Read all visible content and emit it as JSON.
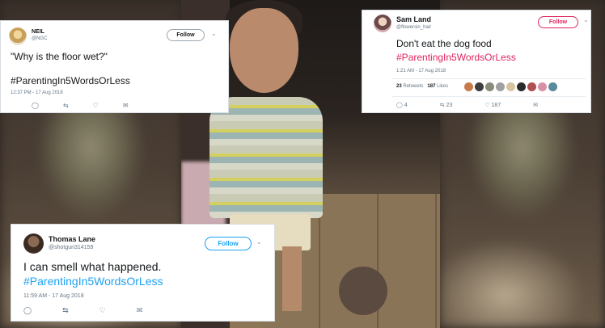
{
  "tweets": [
    {
      "name": "NEIL",
      "handle": "@NGC",
      "follow_label": "Follow",
      "text": "\"Why is the floor wet?\"",
      "hashtag": "#ParentingIn5WordsOrLess",
      "timestamp": "12:37 PM - 17 Aug 2018",
      "icons": [
        "reply-icon",
        "retweet-icon",
        "like-icon",
        "message-icon"
      ]
    },
    {
      "name": "Sam Land",
      "handle": "@flowersin_hair",
      "follow_label": "Follow",
      "text": "Don't eat the dog food",
      "hashtag": "#ParentingIn5WordsOrLess",
      "timestamp": "1:21 AM - 17 Aug 2018",
      "retweets_count": "23",
      "retweets_label": "Retweets",
      "likes_count": "187",
      "likes_label": "Likes",
      "reply_count": "4",
      "retweet_count": "23",
      "like_count": "187",
      "accent_color": "#e0245e",
      "icons": [
        "reply-icon",
        "retweet-icon",
        "like-icon",
        "message-icon"
      ]
    },
    {
      "name": "Thomas Lane",
      "handle": "@shotgun314159",
      "follow_label": "Follow",
      "text": "I can smell what happened.",
      "hashtag": "#ParentingIn5WordsOrLess",
      "timestamp": "11:59 AM - 17 Aug 2018",
      "accent_color": "#1da1f2",
      "icons": [
        "reply-icon",
        "retweet-icon",
        "like-icon",
        "message-icon"
      ]
    }
  ]
}
